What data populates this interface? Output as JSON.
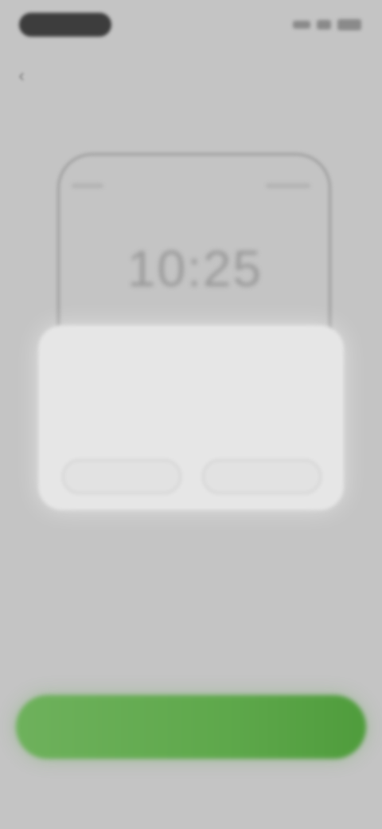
{
  "status_bar": {
    "time": "",
    "icons": [
      "signal-icon",
      "wifi-icon",
      "battery-icon"
    ]
  },
  "nav": {
    "back_icon": "chevron-left-icon",
    "back_glyph": "‹"
  },
  "illustration": {
    "clock_text": "10:25"
  },
  "dialog": {
    "title": "",
    "body": "",
    "left_button": "",
    "right_button": ""
  },
  "content": {
    "headline": "",
    "subtext": ""
  },
  "primary_button": {
    "label": ""
  },
  "colors": {
    "background": "#c4c4c4",
    "accent_green": "#5ea84b",
    "dialog_bg": "#e6e6e6"
  }
}
